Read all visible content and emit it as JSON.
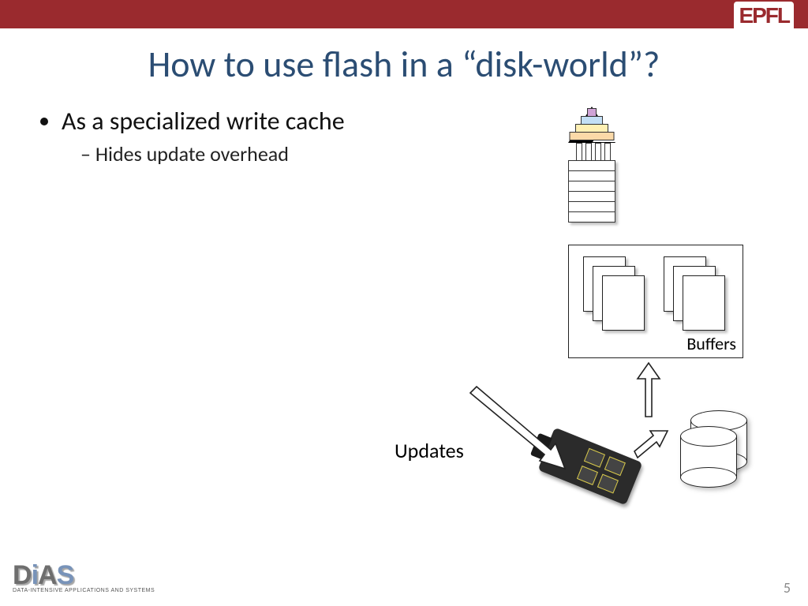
{
  "header": {
    "inst_logo": "EPFL"
  },
  "title": "How to use flash in a “disk-world”?",
  "bullets": {
    "b1": "As a specialized write cache",
    "b1_sub1": "Hides update overhead"
  },
  "diagram": {
    "buffers_label": "Buffers",
    "updates_label": "Updates"
  },
  "footer": {
    "logo_main": "DiAS",
    "logo_sub": "Data-Intensive Applications and Systems",
    "page_number": "5"
  }
}
